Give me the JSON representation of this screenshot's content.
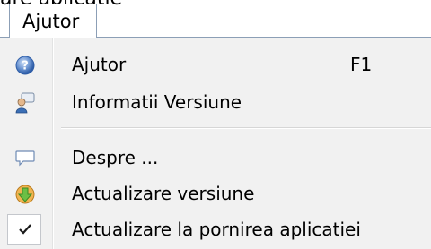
{
  "background_caption": "are aplicatie",
  "menu": {
    "title": "Ajutor",
    "items": [
      {
        "label": "Ajutor",
        "shortcut": "F1",
        "icon": "help-icon"
      },
      {
        "label": "Informatii Versiune",
        "icon": "user-info-icon"
      },
      {
        "label": "Despre ...",
        "icon": "speech-bubble-icon"
      },
      {
        "label": "Actualizare versiune",
        "icon": "update-icon"
      },
      {
        "label": "Actualizare la pornirea aplicatiei",
        "icon": "check-icon",
        "checked": true
      }
    ]
  },
  "colors": {
    "panel": "#f1f1f1",
    "border": "#8c9fb6",
    "help_blue": "#3f6fb8",
    "update_orange": "#e8a13a",
    "update_green": "#5fae3b"
  }
}
